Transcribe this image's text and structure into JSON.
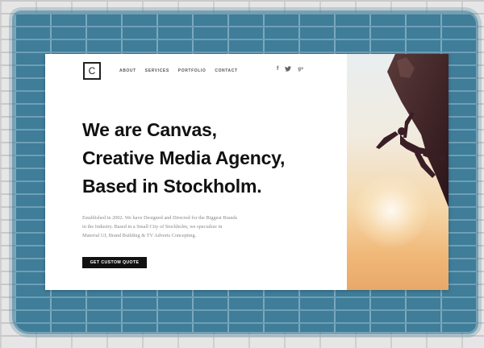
{
  "brand": {
    "logo_letter": "C",
    "logo_icon": "c-logo-icon"
  },
  "nav": {
    "items": [
      "ABOUT",
      "SERVICES",
      "PORTFOLIO",
      "CONTACT"
    ]
  },
  "social": [
    {
      "name": "facebook-icon",
      "glyph": "f"
    },
    {
      "name": "twitter-icon",
      "glyph": "twitter"
    },
    {
      "name": "google-plus-icon",
      "glyph": "g+"
    }
  ],
  "hero": {
    "headline": [
      "We are Canvas,",
      "Creative Media Agency,",
      "Based in Stockholm."
    ],
    "description": [
      "Established in 2002. We have Designed and Directed for the Biggest Brands",
      "in the Industry. Based in a Small City of Stockholm, we specialize in",
      "Material UI, Brand Building & TV Adverts Concepting."
    ],
    "cta_label": "GET CUSTOM QUOTE"
  },
  "image": {
    "subject": "climber-silhouette",
    "colors": {
      "sky_top": "#e9eef0",
      "sky_bottom": "#e9a86a",
      "rock": "#3a1e26"
    }
  },
  "colors": {
    "wall_paint": "#3f7d99",
    "text_dark": "#111111",
    "text_muted": "#888888",
    "cta_bg": "#111111"
  }
}
